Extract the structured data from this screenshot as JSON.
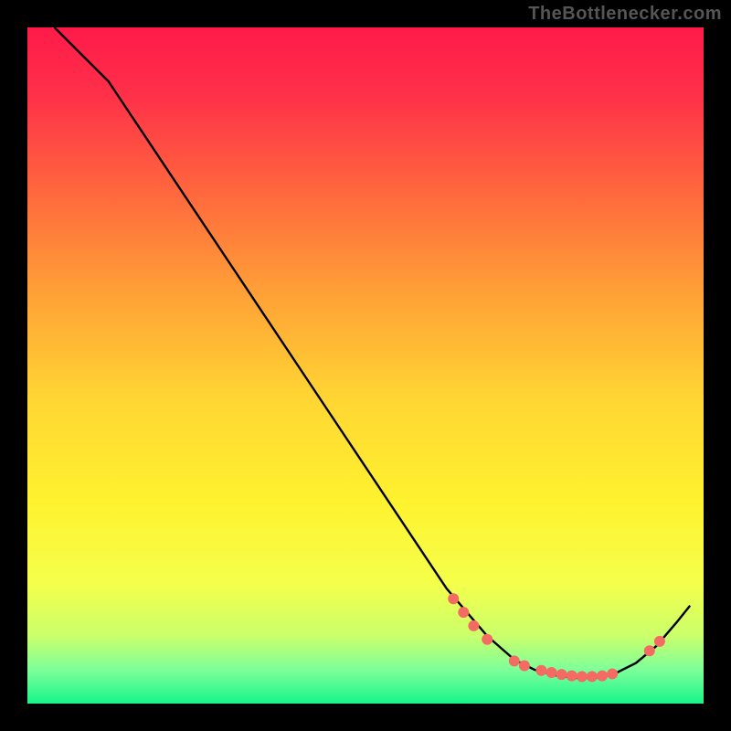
{
  "watermark": "TheBottlenecker.com",
  "chart_data": {
    "type": "line",
    "title": "",
    "xlabel": "",
    "ylabel": "",
    "xlim": [
      0,
      100
    ],
    "ylim": [
      0,
      100
    ],
    "grid": false,
    "curve": [
      {
        "x": 4,
        "y": 100
      },
      {
        "x": 8,
        "y": 96
      },
      {
        "x": 12,
        "y": 92
      },
      {
        "x": 16,
        "y": 86
      },
      {
        "x": 24,
        "y": 74
      },
      {
        "x": 32,
        "y": 62
      },
      {
        "x": 40,
        "y": 50
      },
      {
        "x": 48,
        "y": 38
      },
      {
        "x": 56,
        "y": 26
      },
      {
        "x": 62,
        "y": 17
      },
      {
        "x": 68,
        "y": 10
      },
      {
        "x": 72,
        "y": 6.5
      },
      {
        "x": 75,
        "y": 5
      },
      {
        "x": 78,
        "y": 4.2
      },
      {
        "x": 81,
        "y": 3.8
      },
      {
        "x": 84,
        "y": 3.8
      },
      {
        "x": 87,
        "y": 4.5
      },
      {
        "x": 90,
        "y": 6
      },
      {
        "x": 93,
        "y": 8.5
      },
      {
        "x": 96,
        "y": 12
      },
      {
        "x": 98,
        "y": 14.5
      }
    ],
    "markers": [
      {
        "x": 63,
        "y": 15.5
      },
      {
        "x": 64.5,
        "y": 13.5
      },
      {
        "x": 66,
        "y": 11.5
      },
      {
        "x": 68,
        "y": 9.5
      },
      {
        "x": 72,
        "y": 6.3
      },
      {
        "x": 73.5,
        "y": 5.6
      },
      {
        "x": 76,
        "y": 4.9
      },
      {
        "x": 77.5,
        "y": 4.6
      },
      {
        "x": 79,
        "y": 4.3
      },
      {
        "x": 80.5,
        "y": 4.1
      },
      {
        "x": 82,
        "y": 4.0
      },
      {
        "x": 83.5,
        "y": 4.0
      },
      {
        "x": 85,
        "y": 4.1
      },
      {
        "x": 86.5,
        "y": 4.4
      },
      {
        "x": 92,
        "y": 7.8
      },
      {
        "x": 93.5,
        "y": 9.2
      }
    ],
    "gradient_stops": [
      {
        "offset": 0.0,
        "color": "#ff1a49"
      },
      {
        "offset": 0.1,
        "color": "#ff3049"
      },
      {
        "offset": 0.25,
        "color": "#ff6a3d"
      },
      {
        "offset": 0.4,
        "color": "#ffa336"
      },
      {
        "offset": 0.55,
        "color": "#ffd633"
      },
      {
        "offset": 0.7,
        "color": "#fff22f"
      },
      {
        "offset": 0.82,
        "color": "#f5ff4a"
      },
      {
        "offset": 0.9,
        "color": "#caff6b"
      },
      {
        "offset": 0.95,
        "color": "#7dff9a"
      },
      {
        "offset": 1.0,
        "color": "#17f58b"
      }
    ],
    "marker_color": "#f36b63",
    "curve_color": "#000000"
  }
}
